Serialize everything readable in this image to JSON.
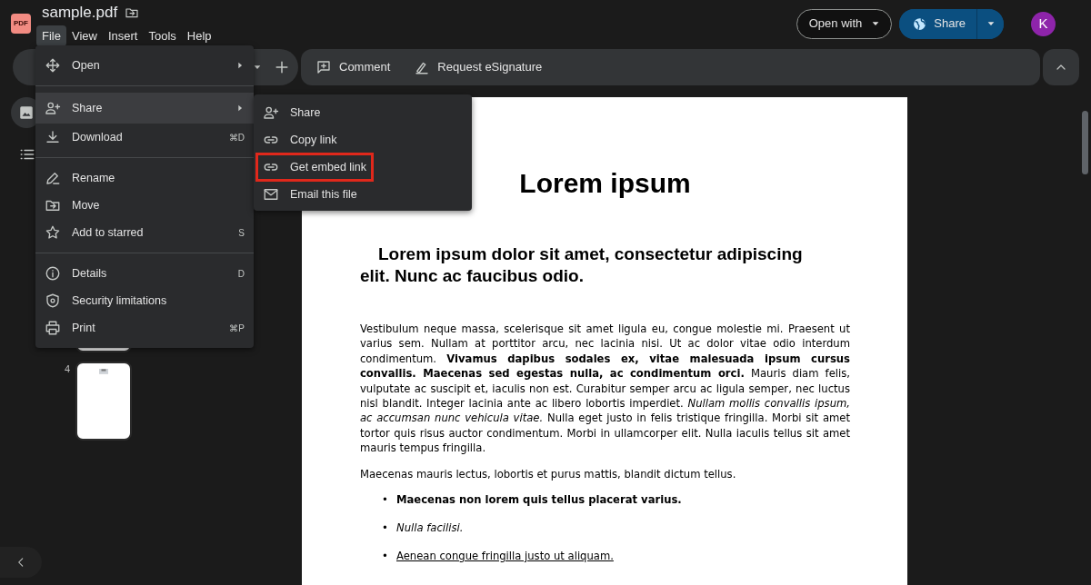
{
  "header": {
    "logo_text": "PDF",
    "file_name": "sample.pdf",
    "menus": [
      {
        "label": "File",
        "selected": true
      },
      {
        "label": "View",
        "selected": false
      },
      {
        "label": "Insert",
        "selected": false
      },
      {
        "label": "Tools",
        "selected": false
      },
      {
        "label": "Help",
        "selected": false
      }
    ],
    "open_with": "Open with",
    "share": "Share",
    "avatar": "K"
  },
  "toolbar": {
    "actions": [
      {
        "label": "Comment"
      },
      {
        "label": "Request eSignature"
      }
    ]
  },
  "thumbnails": [
    {
      "kind": "partial"
    },
    {
      "kind": "page",
      "label": "4"
    }
  ],
  "document": {
    "blocks": [
      {
        "kind": "title",
        "text": "Lorem ipsum"
      },
      {
        "kind": "heading",
        "text": "Lorem ipsum dolor sit amet, consectetur adipiscing elit. Nunc ac faucibus odio."
      },
      {
        "kind": "paragraph",
        "text": "Vestibulum neque massa, scelerisque sit amet ligula eu, congue molestie mi. Praesent ut varius sem. Nullam at porttitor arcu, nec lacinia nisi. Ut ac dolor vitae odio interdum condimentum. **Vivamus dapibus sodales ex, vitae malesuada ipsum cursus convallis. Maecenas sed egestas nulla, ac condimentum orci.** Mauris diam felis, vulputate ac suscipit et, iaculis non est. Curabitur semper arcu ac ligula semper, nec luctus nisl blandit. Integer lacinia ante ac libero lobortis imperdiet. *Nullam mollis convallis ipsum, ac accumsan nunc vehicula vitae.* Nulla eget justo in felis tristique fringilla. Morbi sit amet tortor quis risus auctor condimentum. Morbi in ullamcorper elit. Nulla iaculis tellus sit amet mauris tempus fringilla."
      },
      {
        "kind": "paragraph",
        "text": "Maecenas mauris lectus, lobortis et purus mattis, blandit dictum tellus."
      },
      {
        "kind": "bullets",
        "items": [
          {
            "marker": "•",
            "text": "Maecenas non lorem quis tellus placerat varius."
          },
          {
            "marker": "•",
            "text": "Nulla facilisi."
          },
          {
            "marker": "•",
            "text": "Aenean congue fringilla justo ut aliquam."
          }
        ]
      }
    ]
  },
  "file_menu": {
    "items": [
      {
        "kind": "item",
        "label": "Open",
        "submenu": true,
        "selected": false
      },
      {
        "kind": "divider"
      },
      {
        "kind": "item",
        "label": "Share",
        "submenu": true,
        "selected": true
      },
      {
        "kind": "item",
        "label": "Download",
        "shortcut": "⌘D",
        "selected": false
      },
      {
        "kind": "divider"
      },
      {
        "kind": "item",
        "label": "Rename",
        "selected": false
      },
      {
        "kind": "item",
        "label": "Move",
        "selected": false
      },
      {
        "kind": "item",
        "label": "Add to starred",
        "shortcut": "S",
        "selected": false
      },
      {
        "kind": "divider"
      },
      {
        "kind": "item",
        "label": "Details",
        "shortcut": "D",
        "selected": false
      },
      {
        "kind": "item",
        "label": "Security limitations",
        "selected": false
      },
      {
        "kind": "item",
        "label": "Print",
        "shortcut": "⌘P",
        "selected": false
      }
    ]
  },
  "share_submenu": {
    "items": [
      {
        "label": "Share",
        "highlighted": false
      },
      {
        "label": "Copy link",
        "highlighted": false
      },
      {
        "label": "Get embed link",
        "highlighted": true
      },
      {
        "label": "Email this file",
        "highlighted": false
      }
    ]
  }
}
